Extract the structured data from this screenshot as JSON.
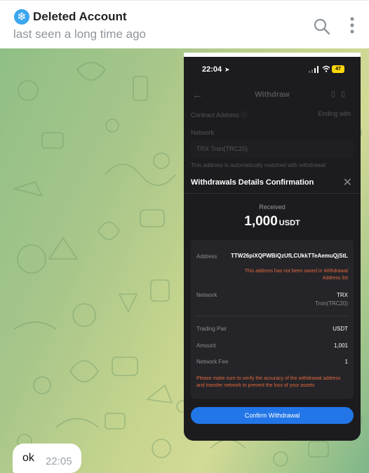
{
  "header": {
    "name": "Deleted Account",
    "status": "last seen a long time ago",
    "avatar_glyph": "❄",
    "icons": [
      "snowflake-icon",
      "search-icon",
      "more-vertical-icon"
    ]
  },
  "image_message": {
    "status_bar": {
      "time": "22:04",
      "battery": "47"
    },
    "background_screen": {
      "title": "Withdraw",
      "contract_label": "Contract Address ⓘ",
      "contract_value": "Ending with",
      "network_label": "Network",
      "network_value": "TRX Tron(TRC20)",
      "note": "This address is automatically matched with withdrawal"
    },
    "sheet": {
      "title": "Withdrawals Details Confirmation",
      "received_label": "Received",
      "received_amount": "1,000",
      "received_unit": "USDT",
      "address_label": "Address",
      "address_value": "TTW26piXQPWBiQzUfLCUkkTTeAemuQjStL",
      "address_warning": "This address has not been saved in Withdrawal Address list",
      "network_label": "Network",
      "network_value": "TRX",
      "network_sub": "Tron(TRC20)",
      "pair_label": "Trading Pair",
      "pair_value": "USDT",
      "amount_label": "Amount",
      "amount_value": "1,001",
      "fee_label": "Network Fee",
      "fee_value": "1",
      "bottom_warning": "Please make sure to verify the accuracy of the withdrawal address and transfer network to prevent the loss of your assets",
      "confirm_label": "Confirm Withdrawal"
    }
  },
  "text_message": {
    "text": "ok",
    "time": "22:05"
  },
  "colors": {
    "accent_blue": "#2276e8",
    "warning_orange": "#e2683d",
    "chat_bg": "#b9d08a"
  }
}
